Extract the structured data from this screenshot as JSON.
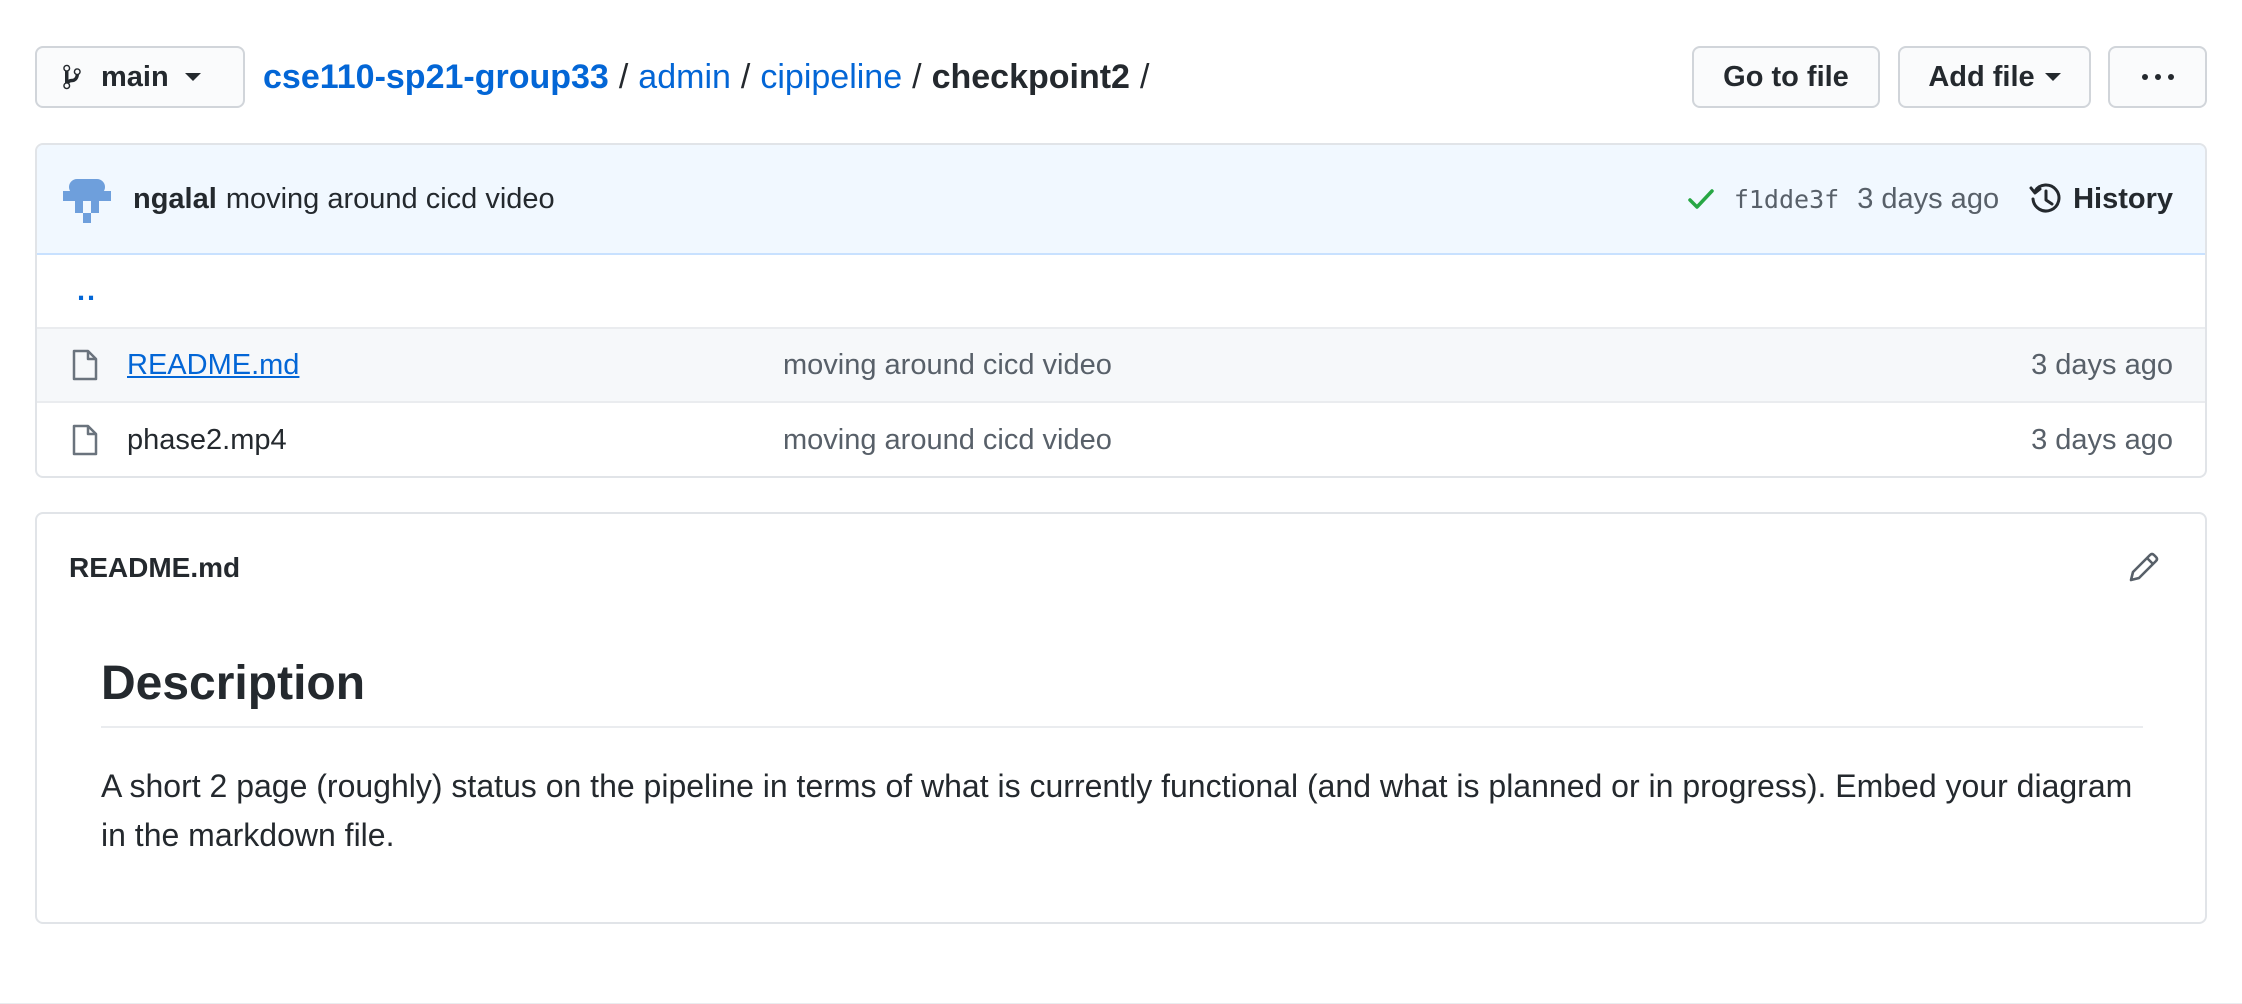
{
  "toolbar": {
    "branch": "main",
    "goto_file": "Go to file",
    "add_file": "Add file",
    "more": "···"
  },
  "breadcrumb": {
    "repo": "cse110-sp21-group33",
    "sep": "/",
    "path": [
      "admin",
      "cipipeline"
    ],
    "current": "checkpoint2"
  },
  "commit": {
    "author": "ngalal",
    "message": "moving around cicd video",
    "sha": "f1dde3f",
    "age": "3 days ago",
    "history_label": "History",
    "status_color": "#28a745"
  },
  "files": {
    "up_label": "..",
    "items": [
      {
        "name": "README.md",
        "message": "moving around cicd video",
        "age": "3 days ago",
        "icon": "file-icon"
      },
      {
        "name": "phase2.mp4",
        "message": "moving around cicd video",
        "age": "3 days ago",
        "icon": "file-icon"
      }
    ]
  },
  "readme": {
    "filename": "README.md",
    "heading": "Description",
    "body": "A short 2 page (roughly) status on the pipeline in terms of what is currently functional (and what is planned or in progress). Embed your diagram in the markdown file."
  },
  "colors": {
    "link": "#0366d6",
    "text": "#24292e",
    "muted": "#586069",
    "commit_bg": "#f1f8ff"
  }
}
